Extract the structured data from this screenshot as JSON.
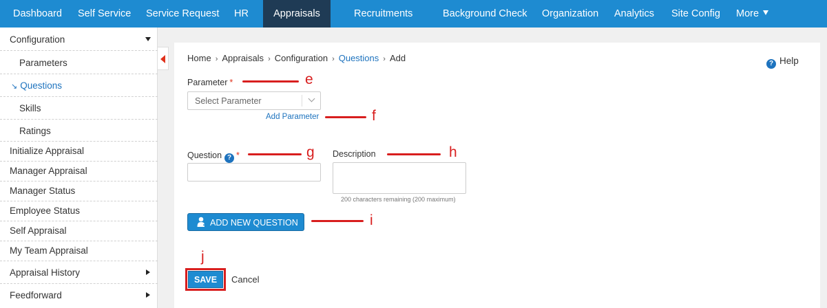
{
  "nav": {
    "items": [
      {
        "label": "Dashboard"
      },
      {
        "label": "Self Service"
      },
      {
        "label": "Service Request"
      },
      {
        "label": "HR"
      },
      {
        "label": "Appraisals",
        "active": true
      },
      {
        "label": "Recruitments"
      },
      {
        "label": "Background Check"
      },
      {
        "label": "Organization"
      },
      {
        "label": "Analytics"
      },
      {
        "label": "Site Config"
      },
      {
        "label": "More"
      }
    ]
  },
  "sidebar": {
    "configuration": "Configuration",
    "parameters": "Parameters",
    "questions": "Questions",
    "skills": "Skills",
    "ratings": "Ratings",
    "initialize_appraisal": "Initialize Appraisal",
    "manager_appraisal": "Manager Appraisal",
    "manager_status": "Manager Status",
    "employee_status": "Employee Status",
    "self_appraisal": "Self Appraisal",
    "my_team_appraisal": "My Team Appraisal",
    "appraisal_history": "Appraisal History",
    "feedforward": "Feedforward"
  },
  "breadcrumb": {
    "home": "Home",
    "appraisals": "Appraisals",
    "configuration": "Configuration",
    "questions": "Questions",
    "current": "Add"
  },
  "help_label": "Help",
  "form": {
    "parameter_label": "Parameter",
    "required_mark": "*",
    "parameter_placeholder": "Select Parameter",
    "add_parameter_link": "Add Parameter",
    "question_label": "Question",
    "description_label": "Description",
    "chars_remaining": "200 characters remaining (200 maximum)",
    "add_new_question_label": "ADD NEW QUESTION",
    "save_label": "SAVE",
    "cancel_label": "Cancel"
  },
  "annotations": {
    "e": "e",
    "f": "f",
    "g": "g",
    "h": "h",
    "i": "i",
    "j": "j",
    "color": "#d81e1e"
  },
  "colors": {
    "nav_bg": "#1e8bd1",
    "nav_active": "#1f3b55",
    "link": "#1e73be"
  }
}
